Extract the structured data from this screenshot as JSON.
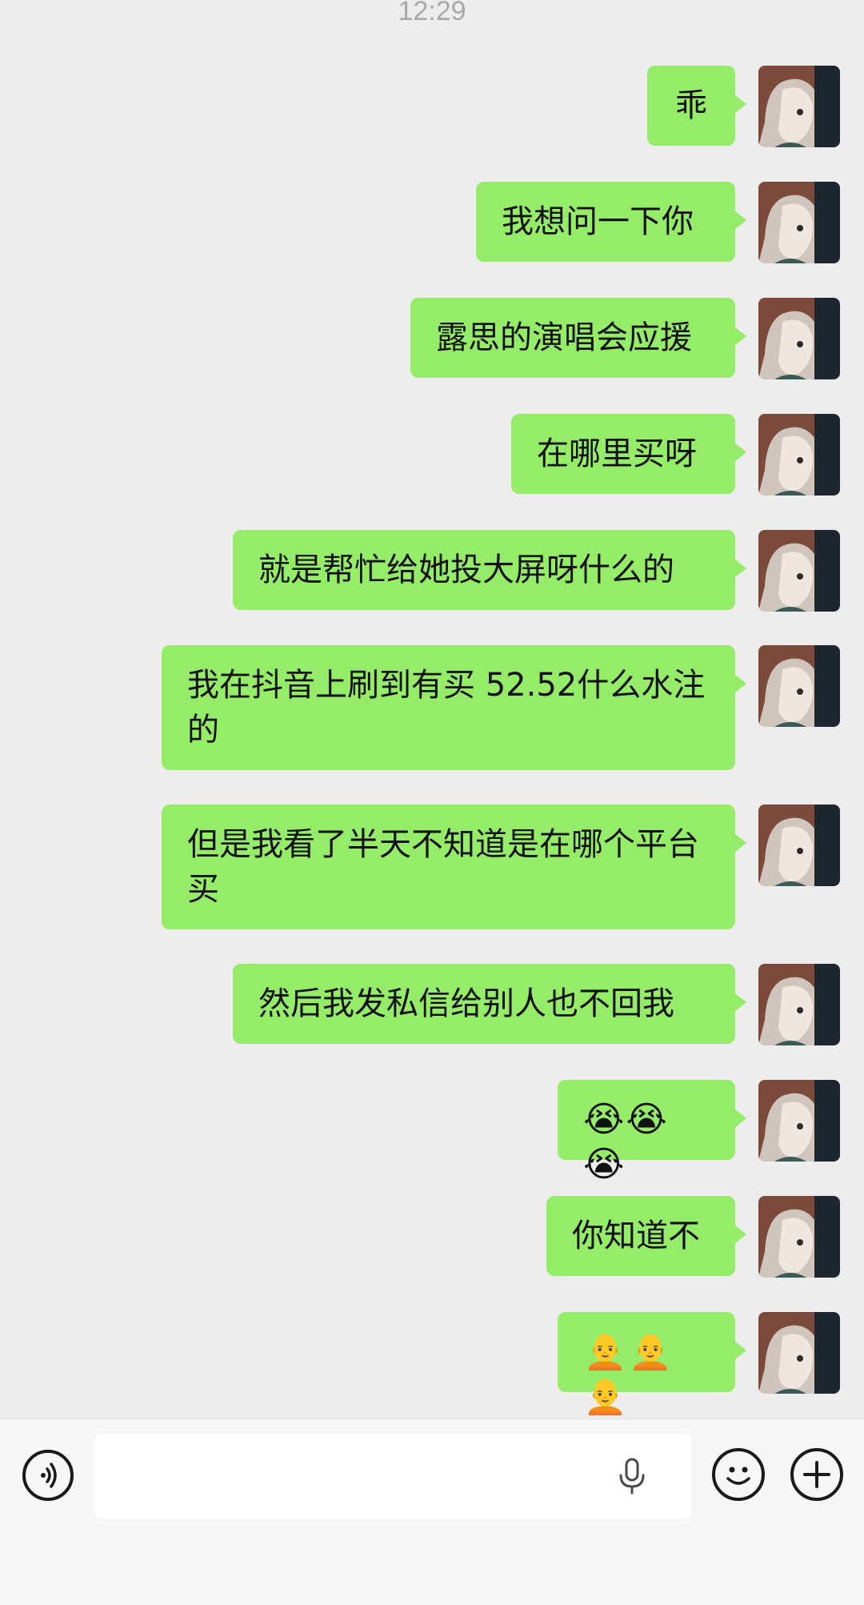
{
  "status": {
    "time": "12:29"
  },
  "messages": [
    {
      "text": "乖"
    },
    {
      "text": "我想问一下你"
    },
    {
      "text": "露思的演唱会应援"
    },
    {
      "text": "在哪里买呀"
    },
    {
      "text": "就是帮忙给她投大屏呀什么的"
    },
    {
      "text": "我在抖音上刷到有买 52.52什么水注的"
    },
    {
      "text": "但是我看了半天不知道是在哪个平台买"
    },
    {
      "text": "然后我发私信给别人也不回我"
    },
    {
      "text": "😭😭😭"
    },
    {
      "text": "你知道不"
    },
    {
      "text": "🧑‍🦲🧑‍🦲🧑‍🦲"
    }
  ],
  "input": {
    "placeholder": ""
  },
  "icons": {
    "voice": "voice-icon",
    "mic": "microphone-icon",
    "emoji": "smiley-icon",
    "plus": "plus-icon"
  },
  "colors": {
    "background": "#ededed",
    "bubble": "#95ec69",
    "bar": "#f7f7f7"
  }
}
